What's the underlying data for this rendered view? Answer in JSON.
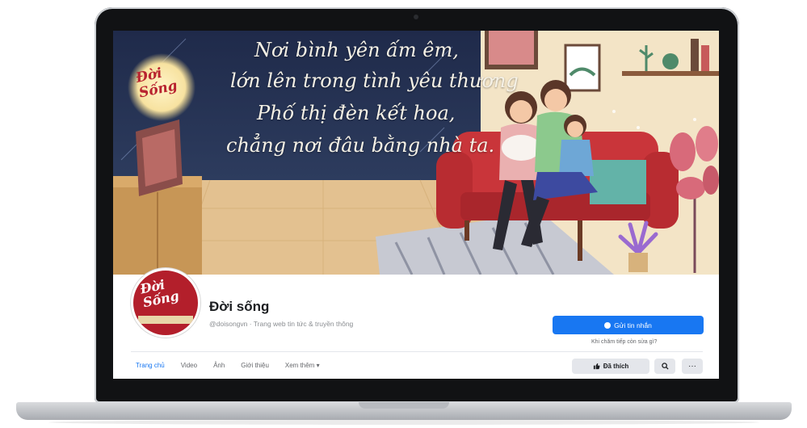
{
  "cover": {
    "moon_text_line1": "Đời",
    "moon_text_line2": "Sống",
    "quote_lines": [
      "Nơi bình yên ấm êm,",
      "lớn lên trong tình yêu thương",
      "Phố thị đèn kết hoa,",
      "chẳng nơi đâu bằng nhà ta."
    ]
  },
  "profile": {
    "avatar_line1": "Đời",
    "avatar_line2": "Sống",
    "name": "Đời sống",
    "handle": "@doisongvn · Trang web tin tức & truyền thông",
    "message_button": "Gửi tin nhắn",
    "small_link": "Khi chăm tiếp còn sửa gì?"
  },
  "tabs": [
    "Trang chủ",
    "Video",
    "Ảnh",
    "Giới thiệu",
    "Xem thêm ▾"
  ],
  "actions": {
    "like_label": "Đã thích",
    "search_icon": "search-icon",
    "more_label": "···"
  },
  "colors": {
    "brand_blue": "#1877f2",
    "logo_red": "#b31f2b",
    "sofa_red": "#c9353a"
  }
}
